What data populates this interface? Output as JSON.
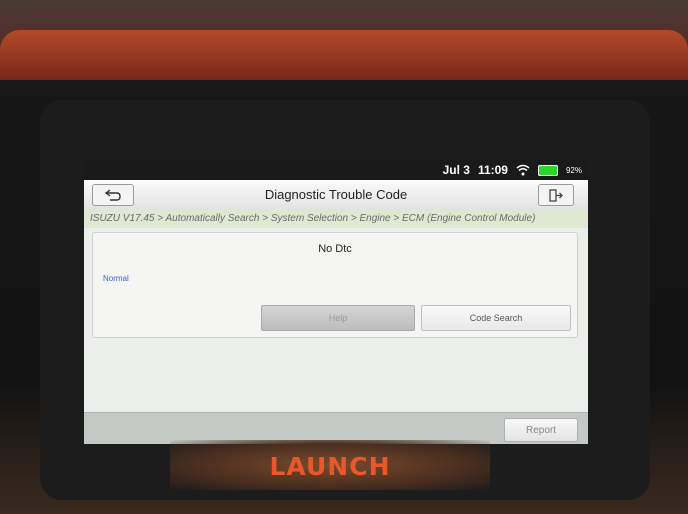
{
  "status_bar": {
    "date": "Jul 3",
    "time": "11:09",
    "battery": "92%"
  },
  "header": {
    "title": "Diagnostic Trouble Code"
  },
  "breadcrumb": "ISUZU V17.45 > Automatically Search > System Selection > Engine > ECM (Engine Control Module)",
  "dtc_panel": {
    "status": "No Dtc",
    "state_label": "Normal",
    "help_label": "Help",
    "code_search_label": "Code Search"
  },
  "footer": {
    "report_label": "Report"
  },
  "device": {
    "brand": "LAUNCH"
  }
}
